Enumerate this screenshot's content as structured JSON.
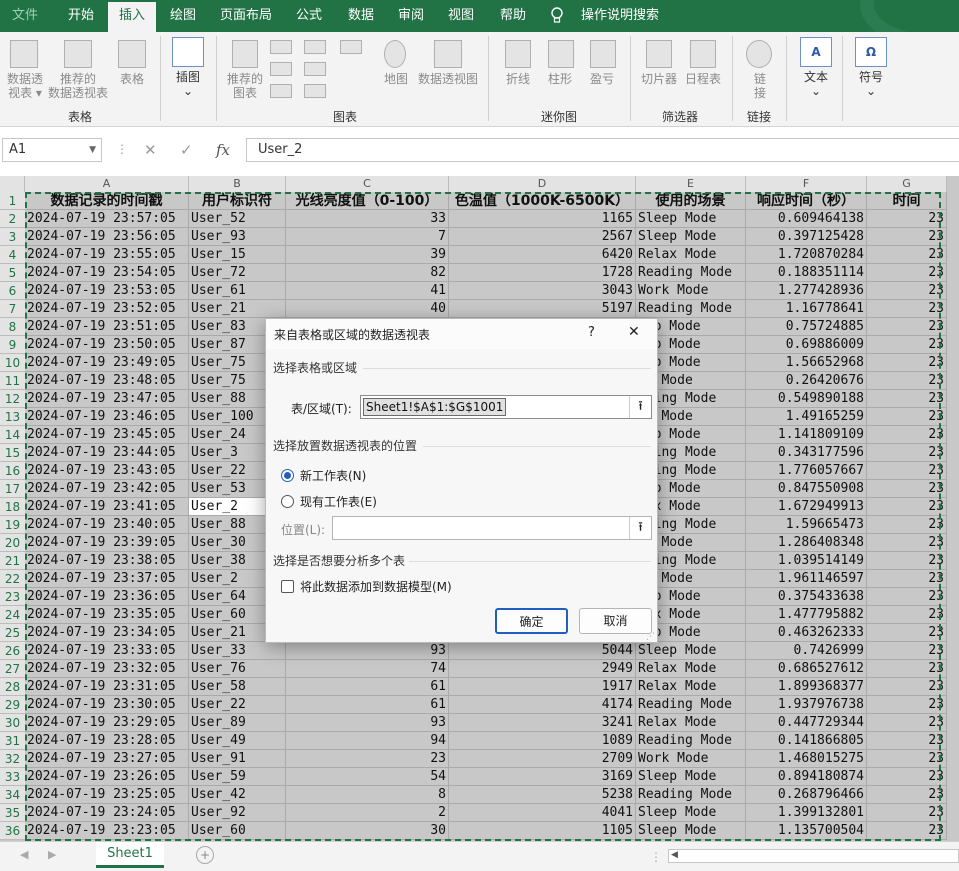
{
  "ribbon_tabs": [
    {
      "label": "文件"
    },
    {
      "label": "开始"
    },
    {
      "label": "插入"
    },
    {
      "label": "绘图"
    },
    {
      "label": "页面布局"
    },
    {
      "label": "公式"
    },
    {
      "label": "数据"
    },
    {
      "label": "审阅"
    },
    {
      "label": "视图"
    },
    {
      "label": "帮助"
    },
    {
      "label": "操作说明搜索"
    }
  ],
  "ribbon": {
    "pivot_label1": "数据透",
    "pivot_label2": "视表 ▾",
    "rec_pivot1": "推荐的",
    "rec_pivot2": "数据透视表",
    "table_label": "表格",
    "illustrations": "插图",
    "rec_chart1": "推荐的",
    "rec_chart2": "图表",
    "map": "地图",
    "pivot_chart": "数据透视图",
    "line": "折线",
    "column": "柱形",
    "winloss": "盈亏",
    "slicer": "切片器",
    "timeline": "日程表",
    "link1": "链",
    "link2": "接",
    "text": "文本",
    "symbol": "符号",
    "group_tables": "表格",
    "group_charts": "图表",
    "group_sparklines": "迷你图",
    "group_filters": "筛选器",
    "group_links": "链接"
  },
  "formula_bar": {
    "name_box": "A1",
    "cancel": "✕",
    "enter": "✓",
    "fx": "fx",
    "content": "User_2"
  },
  "columns": [
    "A",
    "B",
    "C",
    "D",
    "E",
    "F",
    "G"
  ],
  "row_numbers": [
    "1",
    "2",
    "3",
    "4",
    "5",
    "6",
    "7",
    "8",
    "9",
    "10",
    "11",
    "12",
    "13",
    "14",
    "15",
    "16",
    "17",
    "18",
    "19",
    "20",
    "21",
    "22",
    "23",
    "24",
    "25",
    "26",
    "27",
    "28",
    "29",
    "30",
    "31",
    "32",
    "33",
    "34",
    "35",
    "36"
  ],
  "headers": [
    "数据记录的时间戳",
    "用户标识符",
    "光线亮度值（0-100）",
    "色温值（1000K-6500K）",
    "使用的场景",
    "响应时间（秒）",
    "时间"
  ],
  "rows": [
    [
      "2024-07-19 23:57:05",
      "User_52",
      "33",
      "1165",
      "Sleep Mode",
      "0.609464138",
      "23"
    ],
    [
      "2024-07-19 23:56:05",
      "User_93",
      "7",
      "2567",
      "Sleep Mode",
      "0.397125428",
      "23"
    ],
    [
      "2024-07-19 23:55:05",
      "User_15",
      "39",
      "6420",
      "Relax Mode",
      "1.720870284",
      "23"
    ],
    [
      "2024-07-19 23:54:05",
      "User_72",
      "82",
      "1728",
      "Reading Mode",
      "0.188351114",
      "23"
    ],
    [
      "2024-07-19 23:53:05",
      "User_61",
      "41",
      "3043",
      "Work Mode",
      "1.277428936",
      "23"
    ],
    [
      "2024-07-19 23:52:05",
      "User_21",
      "40",
      "5197",
      "Reading Mode",
      "1.16778641",
      "23"
    ],
    [
      "2024-07-19 23:51:05",
      "User_83",
      "",
      "",
      "eep Mode",
      "0.75724885",
      "23"
    ],
    [
      "2024-07-19 23:50:05",
      "User_87",
      "",
      "",
      "eep Mode",
      "0.69886009",
      "23"
    ],
    [
      "2024-07-19 23:49:05",
      "User_75",
      "",
      "",
      "eep Mode",
      "1.56652968",
      "23"
    ],
    [
      "2024-07-19 23:48:05",
      "User_75",
      "",
      "",
      "rk Mode",
      "0.26420676",
      "23"
    ],
    [
      "2024-07-19 23:47:05",
      "User_88",
      "",
      "",
      "ading Mode",
      "0.549890188",
      "23"
    ],
    [
      "2024-07-19 23:46:05",
      "User_100",
      "",
      "",
      "rk Mode",
      "1.49165259",
      "23"
    ],
    [
      "2024-07-19 23:45:05",
      "User_24",
      "",
      "",
      "eep Mode",
      "1.141809109",
      "23"
    ],
    [
      "2024-07-19 23:44:05",
      "User_3",
      "",
      "",
      "ading Mode",
      "0.343177596",
      "23"
    ],
    [
      "2024-07-19 23:43:05",
      "User_22",
      "",
      "",
      "ading Mode",
      "1.776057667",
      "23"
    ],
    [
      "2024-07-19 23:42:05",
      "User_53",
      "",
      "",
      "eep Mode",
      "0.847550908",
      "23"
    ],
    [
      "2024-07-19 23:41:05",
      "User_2",
      "",
      "",
      "lax Mode",
      "1.672949913",
      "23"
    ],
    [
      "2024-07-19 23:40:05",
      "User_88",
      "",
      "",
      "ading Mode",
      "1.59665473",
      "23"
    ],
    [
      "2024-07-19 23:39:05",
      "User_30",
      "",
      "",
      "rk Mode",
      "1.286408348",
      "23"
    ],
    [
      "2024-07-19 23:38:05",
      "User_38",
      "",
      "",
      "ading Mode",
      "1.039514149",
      "23"
    ],
    [
      "2024-07-19 23:37:05",
      "User_2",
      "",
      "",
      "rk Mode",
      "1.961146597",
      "23"
    ],
    [
      "2024-07-19 23:36:05",
      "User_64",
      "",
      "",
      "eep Mode",
      "0.375433638",
      "23"
    ],
    [
      "2024-07-19 23:35:05",
      "User_60",
      "",
      "",
      "lax Mode",
      "1.477795882",
      "23"
    ],
    [
      "2024-07-19 23:34:05",
      "User_21",
      "",
      "",
      "eep Mode",
      "0.463262333",
      "23"
    ],
    [
      "2024-07-19 23:33:05",
      "User_33",
      "93",
      "5044",
      "Sleep Mode",
      "0.7426999",
      "23"
    ],
    [
      "2024-07-19 23:32:05",
      "User_76",
      "74",
      "2949",
      "Relax Mode",
      "0.686527612",
      "23"
    ],
    [
      "2024-07-19 23:31:05",
      "User_58",
      "61",
      "1917",
      "Relax Mode",
      "1.899368377",
      "23"
    ],
    [
      "2024-07-19 23:30:05",
      "User_22",
      "61",
      "4174",
      "Reading Mode",
      "1.937976738",
      "23"
    ],
    [
      "2024-07-19 23:29:05",
      "User_89",
      "93",
      "3241",
      "Relax Mode",
      "0.447729344",
      "23"
    ],
    [
      "2024-07-19 23:28:05",
      "User_49",
      "94",
      "1089",
      "Reading Mode",
      "0.141866805",
      "23"
    ],
    [
      "2024-07-19 23:27:05",
      "User_91",
      "23",
      "2709",
      "Work Mode",
      "1.468015275",
      "23"
    ],
    [
      "2024-07-19 23:26:05",
      "User_59",
      "54",
      "3169",
      "Sleep Mode",
      "0.894180874",
      "23"
    ],
    [
      "2024-07-19 23:25:05",
      "User_42",
      "8",
      "5238",
      "Reading Mode",
      "0.268796466",
      "23"
    ],
    [
      "2024-07-19 23:24:05",
      "User_92",
      "2",
      "4041",
      "Sleep Mode",
      "1.399132801",
      "23"
    ],
    [
      "2024-07-19 23:23:05",
      "User_60",
      "30",
      "1105",
      "Sleep Mode",
      "1.135700504",
      "23"
    ]
  ],
  "dialog": {
    "title": "来自表格或区域的数据透视表",
    "help": "?",
    "close": "✕",
    "sec_range": "选择表格或区域",
    "range_label": "表/区域(T):",
    "range_value": "Sheet1!$A$1:$G$1001",
    "sec_location": "选择放置数据透视表的位置",
    "opt_new": "新工作表(N)",
    "opt_existing": "现有工作表(E)",
    "location_label": "位置(L):",
    "location_value": "",
    "sec_multi": "选择是否想要分析多个表",
    "data_model": "将此数据添加到数据模型(M)",
    "ok": "确定",
    "cancel": "取消"
  },
  "sheet_tab": "Sheet1",
  "add_sheet": "+"
}
